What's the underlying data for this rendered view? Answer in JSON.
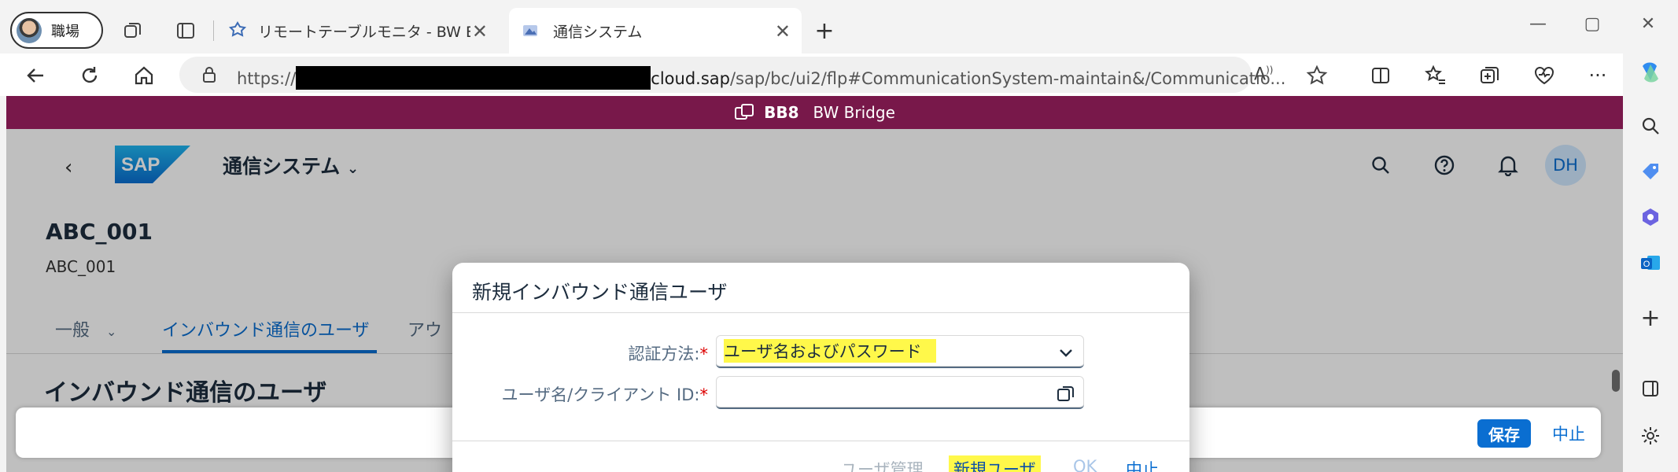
{
  "browser": {
    "profile_name": "職場",
    "tabs": [
      {
        "title": "リモートテーブルモニタ - BW Bridge (S",
        "active": false
      },
      {
        "title": "通信システム",
        "active": true
      }
    ],
    "address": {
      "prefix": "https://",
      "domain": "cloud.sap",
      "path": "/sap/bc/ui2/flp#CommunicationSystem-maintain&/Communicatio..."
    }
  },
  "shell": {
    "system_id": "BB8",
    "system_name": "BW Bridge",
    "app_title": "通信システム",
    "user_initials": "DH"
  },
  "object": {
    "title": "ABC_001",
    "subtitle": "ABC_001"
  },
  "tabs": [
    {
      "label": "一般"
    },
    {
      "label": "インバウンド通信のユーザ"
    },
    {
      "label": "アウ"
    }
  ],
  "section_title": "インバウンド通信のユーザ",
  "footer": {
    "save_label": "保存",
    "cancel_label": "中止"
  },
  "dialog": {
    "title": "新規インバウンド通信ユーザ",
    "auth_label": "認証方法:",
    "auth_value": "ユーザ名およびパスワード",
    "user_label": "ユーザ名/クライアント ID:",
    "user_value": "",
    "required_marker": "*",
    "buttons": {
      "user_mgmt": "ユーザ管理",
      "new_user": "新規ユーザ",
      "ok": "OK",
      "cancel": "中止"
    }
  },
  "colors": {
    "shell_bar": "#78184a",
    "accent": "#0a6ed1",
    "highlight": "#fff84a"
  }
}
